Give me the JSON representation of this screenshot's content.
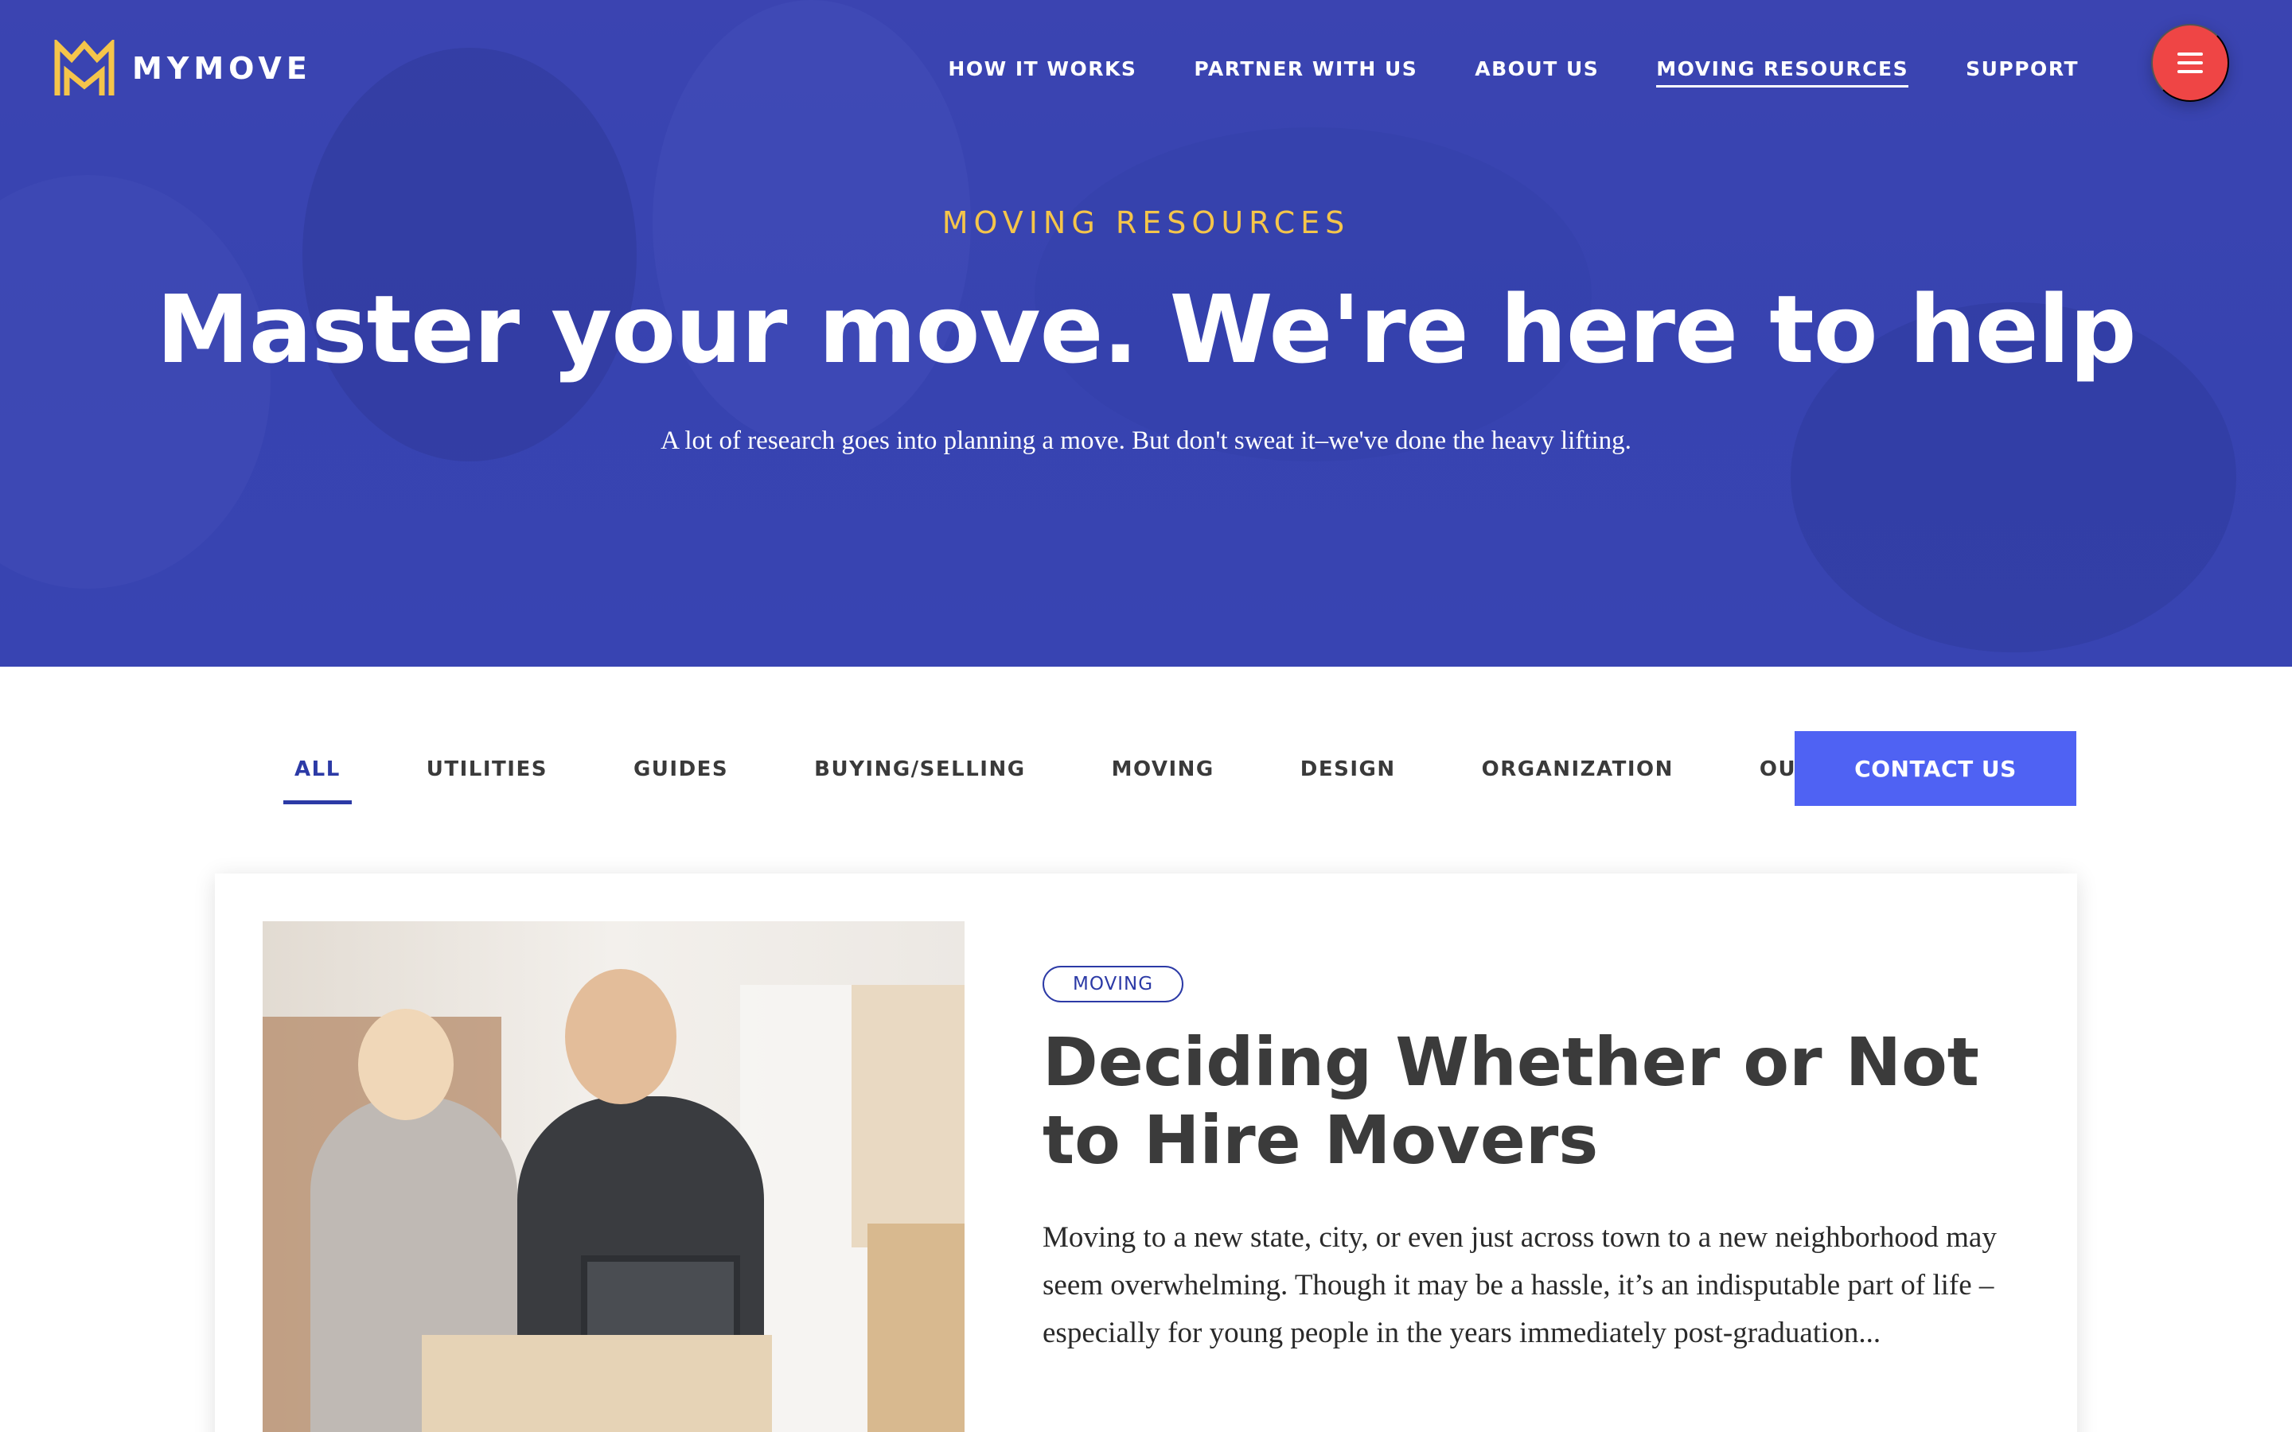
{
  "brand": {
    "name": "MYMOVE",
    "logo_color": "#f5c54a"
  },
  "nav": {
    "items": [
      {
        "label": "HOW IT WORKS",
        "active": false
      },
      {
        "label": "PARTNER WITH US",
        "active": false
      },
      {
        "label": "ABOUT US",
        "active": false
      },
      {
        "label": "MOVING RESOURCES",
        "active": true
      },
      {
        "label": "SUPPORT",
        "active": false
      }
    ],
    "menu_icon": "hamburger-icon",
    "menu_button_color": "#ef4545"
  },
  "hero": {
    "eyebrow": "MOVING RESOURCES",
    "title": "Master your move. We're here to help",
    "subtitle": "A lot of research goes into planning a move. But don't sweat it–we've done the heavy lifting.",
    "overlay_color": "#3a46b1"
  },
  "filters": {
    "items": [
      {
        "label": "ALL",
        "active": true
      },
      {
        "label": "UTILITIES",
        "active": false
      },
      {
        "label": "GUIDES",
        "active": false
      },
      {
        "label": "BUYING/SELLING",
        "active": false
      },
      {
        "label": "MOVING",
        "active": false
      },
      {
        "label": "DESIGN",
        "active": false
      },
      {
        "label": "ORGANIZATION",
        "active": false
      },
      {
        "label": "OUTDOOR",
        "active": false
      }
    ],
    "active_color": "#2c3aa6"
  },
  "contact_button": {
    "label": "CONTACT US",
    "color": "#4f62f3"
  },
  "article": {
    "tag": "MOVING",
    "title_line1": "Deciding Whether or Not",
    "title_line2": "to Hire Movers",
    "excerpt": "Moving to a new state, city, or even just across town to a new neighborhood may seem overwhelming. Though it may be a hassle, it’s an indisputable part of life – especially for young people in the years immediately post-graduation..."
  }
}
